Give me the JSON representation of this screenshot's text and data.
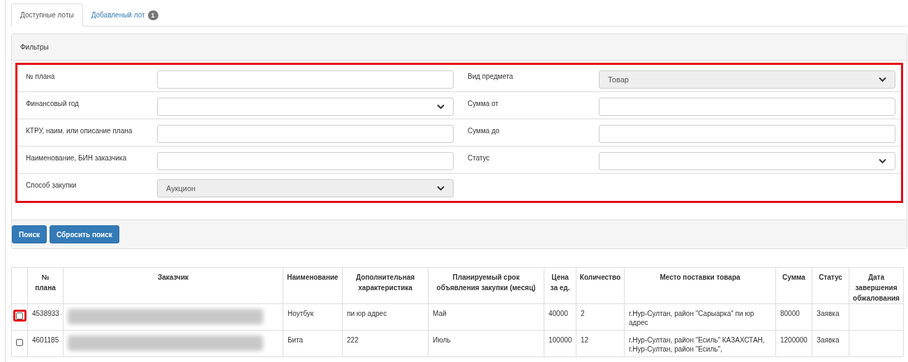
{
  "tabs": [
    {
      "label": "Доступные лоты",
      "selected": true
    },
    {
      "label": "Добавленый лот",
      "badge": "1",
      "selected": false
    }
  ],
  "filters": {
    "title": "Фильтры",
    "highlighted": true,
    "left": [
      {
        "label": "№ плана",
        "kind": "input"
      },
      {
        "label": "Финансовый год",
        "kind": "select"
      },
      {
        "label": "КТРУ, наим. или описание плана",
        "kind": "input"
      },
      {
        "label": "Наименование, БИН заказчика",
        "kind": "input"
      },
      {
        "label": "Способ закупки",
        "kind": "select",
        "value": "Аукцион",
        "disabled": true
      }
    ],
    "right": [
      {
        "label": "Вид предмета",
        "kind": "select",
        "value": "Товар",
        "disabled": true
      },
      {
        "label": "Сумма от",
        "kind": "input"
      },
      {
        "label": "Сумма до",
        "kind": "input"
      },
      {
        "label": "Статус",
        "kind": "select"
      }
    ],
    "buttons": [
      "Поиск",
      "Сбросить поиск"
    ]
  },
  "table": {
    "columns": [
      "№ плана",
      "Заказчик",
      "Наименование",
      "Дополнительная характеристика",
      "Планируемый срок объявления закупки (месяц)",
      "Цена за ед.",
      "Количество",
      "Место поставки товара",
      "Сумма",
      "Статус",
      "Дата завершения обжалования"
    ],
    "rows": [
      {
        "checked": false,
        "highlighted": true,
        "cells": [
          "4538933",
          null,
          "Ноутбук",
          "пи юр адрес",
          "Май",
          "40000",
          "2",
          "г.Нур-Султан, район \"Сарыарка\" пи юр адрес",
          "80000",
          "Заявка",
          null
        ]
      },
      {
        "checked": false,
        "highlighted": false,
        "cells": [
          "4601185",
          null,
          "Бита",
          "222",
          "Июль",
          "100000",
          "12",
          "г.Нур-Султан, район \"Есиль\" КАЗАХСТАН, г.Нур-Султан, район \"Есиль\",",
          "1200000",
          "Заявка",
          null
        ]
      }
    ]
  }
}
